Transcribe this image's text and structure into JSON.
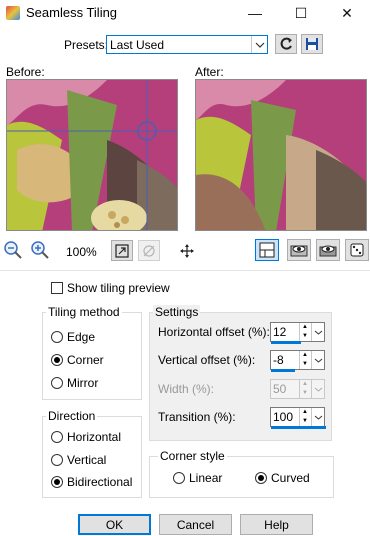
{
  "window": {
    "title": "Seamless Tiling",
    "minimize": "—",
    "maximize": "☐",
    "close": "✕"
  },
  "presets": {
    "label": "Presets:",
    "value": "Last Used"
  },
  "preview": {
    "before_label": "Before:",
    "after_label": "After:"
  },
  "zoom": {
    "percent": "100%"
  },
  "show_tiling_preview": {
    "label": "Show tiling preview",
    "checked": false
  },
  "tiling_method": {
    "title": "Tiling method",
    "options": [
      "Edge",
      "Corner",
      "Mirror"
    ],
    "selected": "Corner"
  },
  "direction": {
    "title": "Direction",
    "options": [
      "Horizontal",
      "Vertical",
      "Bidirectional"
    ],
    "selected": "Bidirectional"
  },
  "settings": {
    "title": "Settings",
    "horizontal_offset": {
      "label": "Horizontal offset (%):",
      "value": "12"
    },
    "vertical_offset": {
      "label": "Vertical offset (%):",
      "value": "-8"
    },
    "width": {
      "label": "Width (%):",
      "value": "50"
    },
    "transition": {
      "label": "Transition (%):",
      "value": "100"
    }
  },
  "corner_style": {
    "title": "Corner style",
    "options": [
      "Linear",
      "Curved"
    ],
    "selected": "Curved"
  },
  "buttons": {
    "ok": "OK",
    "cancel": "Cancel",
    "help": "Help"
  },
  "colors": {
    "accent": "#0078d7",
    "crosshair": "#4a5fb5"
  }
}
